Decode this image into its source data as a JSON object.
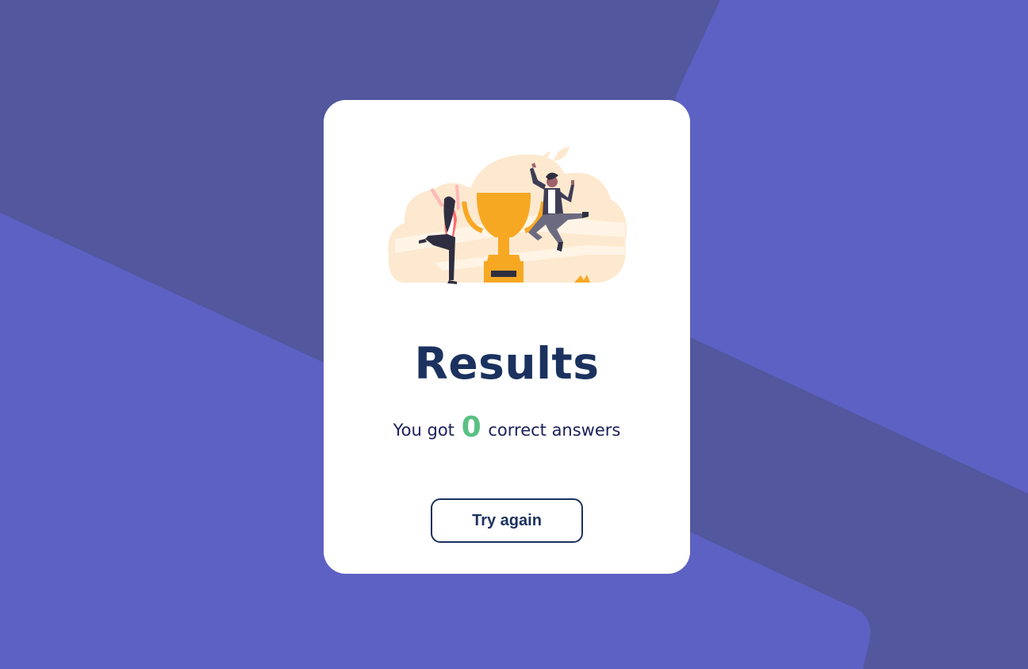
{
  "colors": {
    "background": "#5c61c3",
    "background_shape": "#52579e",
    "card": "#ffffff",
    "title": "#1b325f",
    "score_highlight": "#5bc083",
    "button_border": "#1b325f",
    "trophy": "#f7a823"
  },
  "illustration": {
    "icon": "celebration-trophy-illustration"
  },
  "results": {
    "title": "Results",
    "prefix": "You got",
    "score": "0",
    "suffix": "correct answers"
  },
  "actions": {
    "try_again_label": "Try again"
  }
}
